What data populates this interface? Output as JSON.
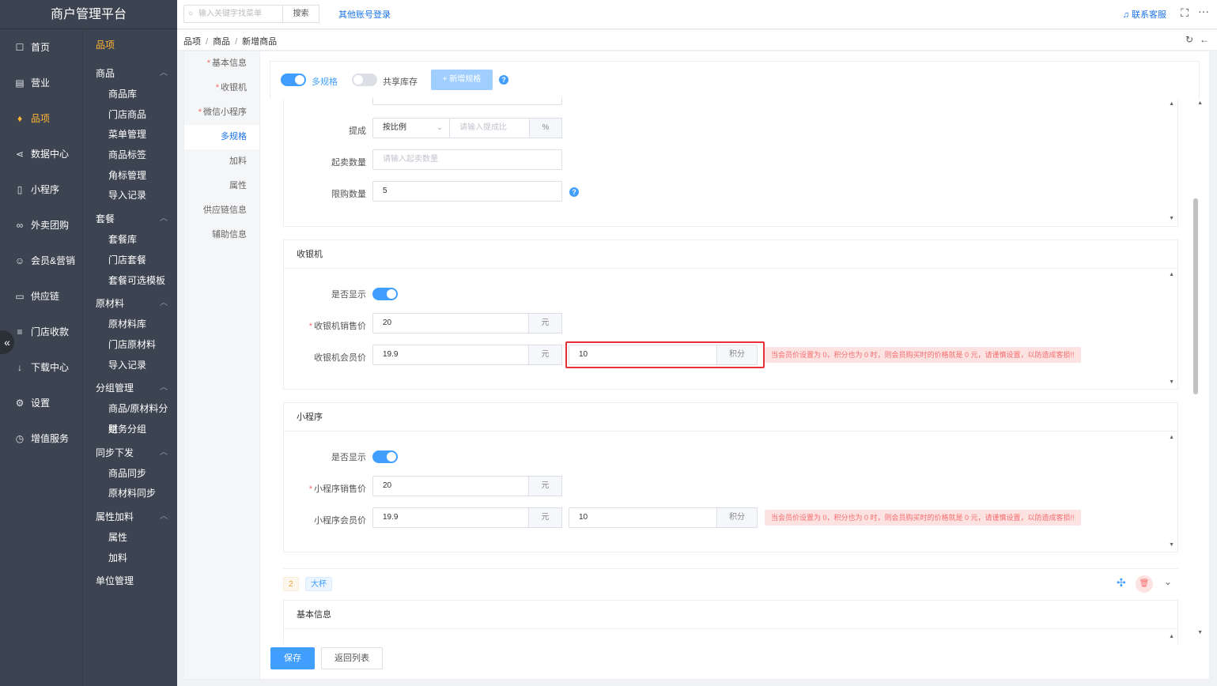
{
  "app_title": "商户管理平台",
  "nav": [
    {
      "label": "首页",
      "icon": "home-icon",
      "glyph": "☐"
    },
    {
      "label": "营业",
      "icon": "calendar-icon",
      "glyph": "▤"
    },
    {
      "label": "品项",
      "icon": "bag-icon",
      "glyph": "♦"
    },
    {
      "label": "数据中心",
      "icon": "share-icon",
      "glyph": "⋖"
    },
    {
      "label": "小程序",
      "icon": "phone-icon",
      "glyph": "▯"
    },
    {
      "label": "外卖团购",
      "icon": "bike-icon",
      "glyph": "∞"
    },
    {
      "label": "会员&营销",
      "icon": "user-icon",
      "glyph": "☺"
    },
    {
      "label": "供应链",
      "icon": "truck-icon",
      "glyph": "▭"
    },
    {
      "label": "门店收款",
      "icon": "database-icon",
      "glyph": "≡"
    },
    {
      "label": "下载中心",
      "icon": "download-icon",
      "glyph": "↓"
    },
    {
      "label": "设置",
      "icon": "gear-icon",
      "glyph": "⚙"
    },
    {
      "label": "增值服务",
      "icon": "clock-icon",
      "glyph": "◷"
    }
  ],
  "submenu": {
    "title": "品项",
    "groups": [
      {
        "label": "商品",
        "items": [
          "商品库",
          "门店商品",
          "菜单管理",
          "商品标签",
          "角标管理",
          "导入记录"
        ]
      },
      {
        "label": "套餐",
        "items": [
          "套餐库",
          "门店套餐",
          "套餐可选模板"
        ]
      },
      {
        "label": "原材料",
        "items": [
          "原材料库",
          "门店原材料",
          "导入记录"
        ]
      },
      {
        "label": "分组管理",
        "items": [
          "商品/原材料分组",
          "财务分组"
        ]
      },
      {
        "label": "同步下发",
        "items": [
          "商品同步",
          "原材料同步"
        ]
      },
      {
        "label": "属性加料",
        "items": [
          "属性",
          "加料"
        ]
      }
    ],
    "last": "单位管理"
  },
  "topbar": {
    "search_placeholder": "输入关键字找菜单",
    "search_button": "搜索",
    "other_login": "其他账号登录",
    "contact": "联系客服"
  },
  "breadcrumb": [
    "品项",
    "商品",
    "新增商品"
  ],
  "tabs": [
    {
      "label": "基本信息",
      "required": true
    },
    {
      "label": "收银机",
      "required": true
    },
    {
      "label": "微信小程序",
      "required": true
    },
    {
      "label": "多规格",
      "required": false
    },
    {
      "label": "加料",
      "required": false
    },
    {
      "label": "属性",
      "required": false
    },
    {
      "label": "供应链信息",
      "required": false
    },
    {
      "label": "辅助信息",
      "required": false
    }
  ],
  "toolbar": {
    "multi_spec": "多规格",
    "shared_stock": "共享库存",
    "add_spec": "+ 新增规格"
  },
  "upper": {
    "commission_label": "提成",
    "commission_mode": "按比例",
    "commission_placeholder": "请输入提成比",
    "percent": "%",
    "min_qty_label": "起卖数量",
    "min_qty_placeholder": "请输入起卖数量",
    "limit_label": "限购数量",
    "limit_value": "5"
  },
  "cashier": {
    "title": "收银机",
    "show_label": "是否显示",
    "price_label": "收银机销售价",
    "price_value": "20",
    "unit": "元",
    "member_label": "收银机会员价",
    "member_value": "19.9",
    "points_value": "10",
    "points_unit": "积分",
    "warning": "当会员价设置为 0，积分也为 0 时，则会员购买时的价格就是 0 元，请谨慎设置，以防造成客损!!"
  },
  "mini": {
    "title": "小程序",
    "show_label": "是否显示",
    "price_label": "小程序销售价",
    "price_value": "20",
    "unit": "元",
    "member_label": "小程序会员价",
    "member_value": "19.9",
    "points_value": "10",
    "points_unit": "积分",
    "warning": "当会员价设置为 0，积分也为 0 时，则会员购买时的价格就是 0 元，请谨慎设置，以防造成客损!!"
  },
  "sku2": {
    "index": "2",
    "name": "大杯",
    "section": "基本信息"
  },
  "footer": {
    "save": "保存",
    "back": "返回列表"
  }
}
